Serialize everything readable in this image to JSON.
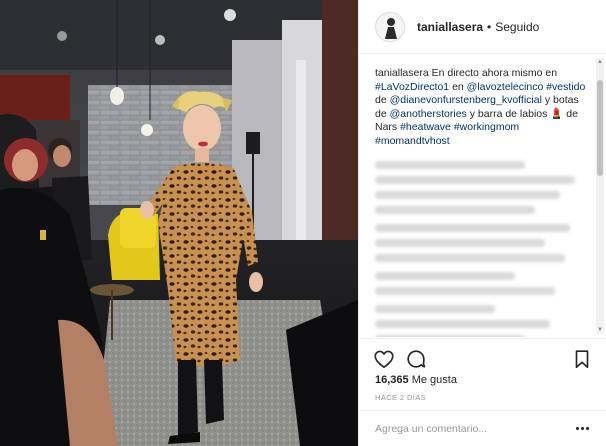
{
  "post": {
    "username": "taniallasera",
    "separator": "•",
    "follow_status": "Seguido"
  },
  "caption": {
    "username": "taniallasera",
    "text_1": "En directo ahora mismo en",
    "tag_1": "#LaVozDirecto1",
    "text_2": "en",
    "mention_1": "@lavoztelecinco",
    "tag_2": "#vestido",
    "text_3": "de",
    "mention_2": "@dianevonfurstenberg_kvofficial",
    "text_4": "y botas de",
    "mention_3": "@anotherstories",
    "text_5": "y barra de labios",
    "emoji": "💄",
    "text_6": "de Nars",
    "tag_3": "#heatwave",
    "tag_4": "#workingmom",
    "tag_5": "#momandtvhost"
  },
  "likes": {
    "count": "16,365",
    "label": "Me gusta"
  },
  "time_ago": "HACE 2 DÍAS",
  "comment_input": {
    "placeholder": "Agrega un comentario..."
  },
  "icons": {
    "like": "heart-icon",
    "comment": "speech-bubble-icon",
    "save": "bookmark-icon",
    "more": "ellipsis-icon"
  },
  "colors": {
    "link": "#003569",
    "text": "#262626",
    "muted": "#999999",
    "border": "#efefef"
  }
}
